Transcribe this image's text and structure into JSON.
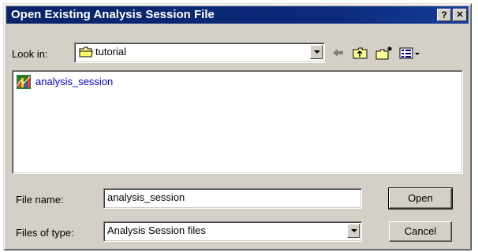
{
  "window": {
    "title": "Open Existing Analysis Session File",
    "help_label": "?",
    "close_label": "✕"
  },
  "look_in": {
    "label": "Look in:",
    "value": "tutorial",
    "icon": "folder-icon"
  },
  "toolbar": {
    "back_icon": "back-arrow-icon",
    "up_icon": "up-folder-icon",
    "new_folder_icon": "new-folder-icon",
    "view_icon": "view-menu-icon"
  },
  "files": [
    {
      "name": "analysis_session",
      "icon": "analysis-session-file-icon"
    }
  ],
  "file_name": {
    "label": "File name:",
    "value": "analysis_session"
  },
  "file_type": {
    "label": "Files of type:",
    "value": "Analysis Session files"
  },
  "buttons": {
    "open": "Open",
    "cancel": "Cancel"
  },
  "colors": {
    "title_bar": "#0a246a",
    "dialog_face": "#d4d0c8",
    "file_text": "#0000cc"
  }
}
